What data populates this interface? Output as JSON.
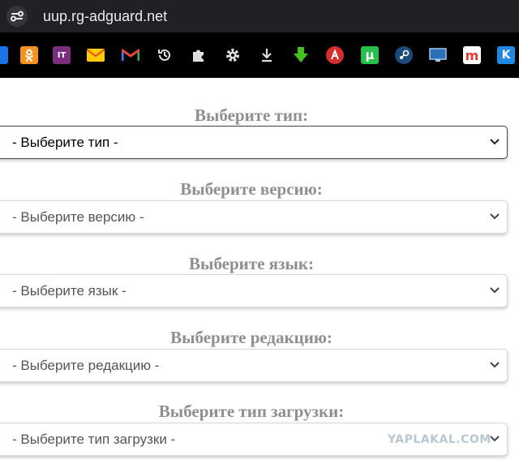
{
  "browser": {
    "url": "uup.rg-adguard.net",
    "site_info_icon": "tune-icon",
    "bookmarks": [
      {
        "name": "blue-bookmark-icon",
        "color": "#1a73e8"
      },
      {
        "name": "odnoklassniki-icon",
        "color": "#f7931e"
      },
      {
        "name": "it-bookmark-icon",
        "label": "IT",
        "color": "#7b2d7f"
      },
      {
        "name": "mail-envelope-icon",
        "color": "#ffcc00"
      },
      {
        "name": "gmail-icon",
        "color": "#ea4335"
      },
      {
        "name": "history-icon",
        "color": "#e0e0e0"
      },
      {
        "name": "puzzle-icon",
        "color": "#e0e0e0"
      },
      {
        "name": "gear-icon",
        "color": "#e0e0e0"
      },
      {
        "name": "download-icon",
        "color": "#e0e0e0"
      },
      {
        "name": "green-download-icon",
        "color": "#44c21c"
      },
      {
        "name": "anime-bookmark-icon",
        "color": "#d32f2f"
      },
      {
        "name": "utorrent-icon",
        "label": "µ",
        "color": "#27c04a"
      },
      {
        "name": "steam-icon",
        "color": "#1b4b7a"
      },
      {
        "name": "monitor-bookmark-icon",
        "color": "#2a6fb5"
      },
      {
        "name": "m-bookmark-icon",
        "label": "m",
        "color": "#e53935"
      },
      {
        "name": "k-bookmark-icon",
        "label": "K",
        "color": "#1e88e5"
      }
    ]
  },
  "form": {
    "type": {
      "label": "Выберите тип:",
      "value": "- Выберите тип -"
    },
    "version": {
      "label": "Выберите версию:",
      "value": "- Выберите версию -"
    },
    "language": {
      "label": "Выберите язык:",
      "value": "- Выберите язык -"
    },
    "edition": {
      "label": "Выберите редакцию:",
      "value": "- Выберите редакцию -"
    },
    "download_type": {
      "label": "Выберите тип загрузки:",
      "value": "- Выберите тип загрузки -"
    }
  },
  "watermark": "YAPLAKAL.COM",
  "colors": {
    "addressbar_bg": "#202124",
    "bookmarks_bg": "#000000",
    "label_text": "#8f8f8f",
    "select_border_focused": "#444444"
  }
}
